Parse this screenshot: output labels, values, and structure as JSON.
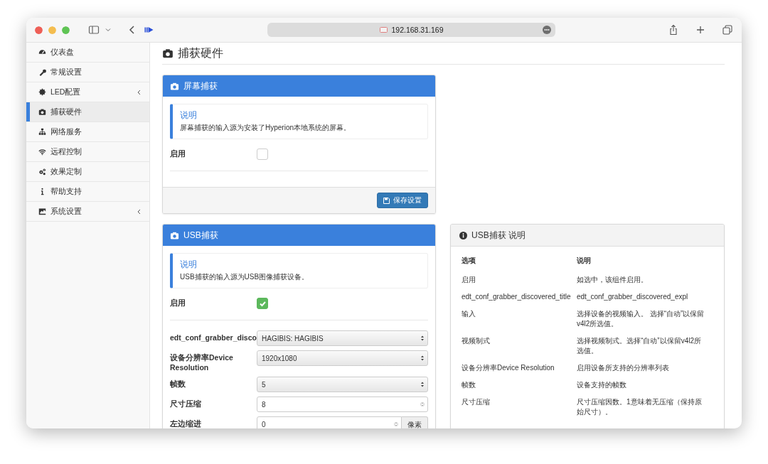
{
  "browser": {
    "address": "192.168.31.169"
  },
  "sidebar": {
    "items": [
      {
        "label": "仪表盘",
        "selected": false,
        "expandable": false
      },
      {
        "label": "常规设置",
        "selected": false,
        "expandable": false
      },
      {
        "label": "LED配置",
        "selected": false,
        "expandable": true
      },
      {
        "label": "捕获硬件",
        "selected": true,
        "expandable": false
      },
      {
        "label": "网络服务",
        "selected": false,
        "expandable": false
      },
      {
        "label": "远程控制",
        "selected": false,
        "expandable": false
      },
      {
        "label": "效果定制",
        "selected": false,
        "expandable": false
      },
      {
        "label": "帮助支持",
        "selected": false,
        "expandable": false
      },
      {
        "label": "系统设置",
        "selected": false,
        "expandable": true
      }
    ]
  },
  "page_title": "捕获硬件",
  "screen_panel": {
    "title": "屏幕捕获",
    "note": {
      "title": "说明",
      "text": "屏幕捕获的输入源为安装了Hyperion本地系统的屏幕。"
    },
    "enable": {
      "label": "启用",
      "checked": false
    },
    "save_button": "保存设置"
  },
  "usb_panel": {
    "title": "USB捕获",
    "note": {
      "title": "说明",
      "text": "USB捕获的输入源为USB图像捕获设备。"
    },
    "enable": {
      "label": "启用",
      "checked": true
    },
    "fields": [
      {
        "kind": "select",
        "label": "edt_conf_grabber_disco",
        "value": "HAGIBIS: HAGIBIS"
      },
      {
        "kind": "select",
        "label": "设备分辨率Device Resolution",
        "value": "1920x1080"
      },
      {
        "kind": "select",
        "label": "帧数",
        "value": "5"
      },
      {
        "kind": "number",
        "label": "尺寸压缩",
        "value": "8"
      },
      {
        "kind": "unit",
        "label": "左边缩进",
        "value": "0",
        "unit": "像素"
      }
    ]
  },
  "info_panel": {
    "title": "USB捕获 说明",
    "columns": [
      "选项",
      "说明"
    ],
    "rows": [
      [
        "启用",
        "如选中，该组件启用。"
      ],
      [
        "edt_conf_grabber_discovered_title",
        "edt_conf_grabber_discovered_expl"
      ],
      [
        "输入",
        "选择设备的视频输入。 选择“自动”以保留v4l2所选值。"
      ],
      [
        "视频制式",
        "选择视频制式。选择“自动”以保留v4l2所选值。"
      ],
      [
        "设备分辨率Device Resolution",
        "启用设备所支持的分辨率列表"
      ],
      [
        "帧数",
        "设备支持的帧数"
      ],
      [
        "尺寸压缩",
        "尺寸压缩因数。1意味着无压缩（保持原始尺寸）。"
      ]
    ]
  }
}
